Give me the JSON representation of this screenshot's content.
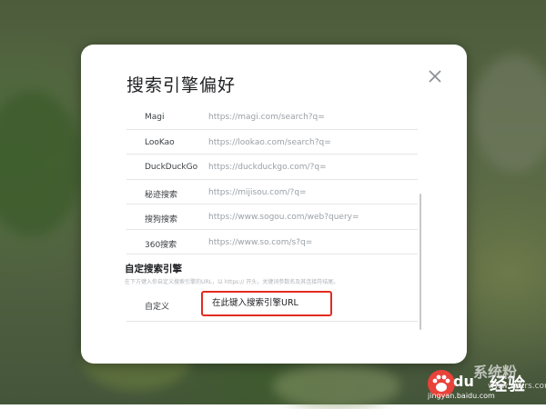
{
  "dialog": {
    "title": "搜索引擎偏好"
  },
  "engines": [
    {
      "name": "Magi",
      "url": "https://magi.com/search?q="
    },
    {
      "name": "LooKao",
      "url": "https://lookao.com/search?q="
    },
    {
      "name": "DuckDuckGo",
      "url": "https://duckduckgo.com/?q="
    },
    {
      "name": "秘迹搜索",
      "url": "https://mijisou.com/?q="
    },
    {
      "name": "搜狗搜索",
      "url": "https://www.sogou.com/web?query="
    },
    {
      "name": "360搜索",
      "url": "https://www.so.com/s?q="
    }
  ],
  "custom": {
    "section_title": "自定搜索引擎",
    "description": "在下方键入你自定义搜索引擎的URL，以 https:// 开头，关键词参数名及其连接符结尾。",
    "label": "自定义",
    "input_value": "在此键入搜索引擎URL",
    "highlight_color": "#e22b1f"
  },
  "watermark": {
    "du": "du",
    "jingyan": "经验",
    "domain": "jingyan.baidu.com",
    "site": "系统粉",
    "site_url": "www.xhkrs.com"
  },
  "icons": {
    "close": "close-icon",
    "paw": "baidu-paw-icon"
  }
}
